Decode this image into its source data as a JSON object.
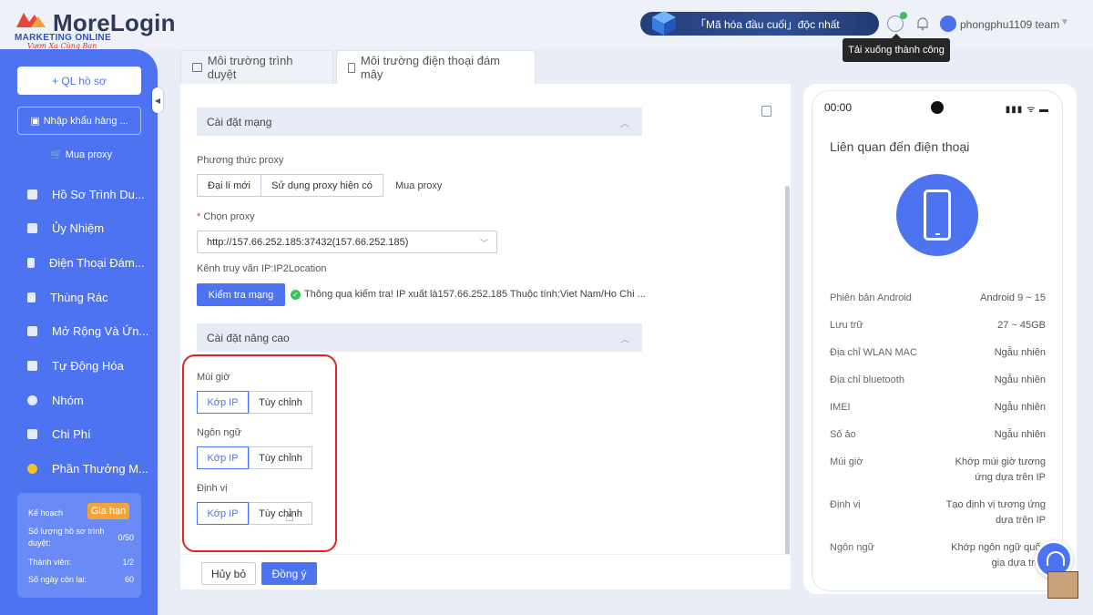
{
  "app": {
    "logo_text": "MoreLogin",
    "watermark_line1": "MARKETING ONLINE",
    "watermark_line2": "Vươn Xa Cùng Bạn",
    "promo_text": "「Mã hóa đầu cuối」độc nhất",
    "username": "phongphu1109 team",
    "tooltip": "Tải xuống thành công"
  },
  "sidebar": {
    "new_profile": "+ QL hồ sơ",
    "import": "Nhập khẩu hàng ...",
    "buy_proxy": "Mua proxy",
    "items": [
      {
        "label": "Hồ Sơ Trình Du...",
        "icon": "browser-profile-icon"
      },
      {
        "label": "Ủy Nhiệm",
        "icon": "delegate-icon"
      },
      {
        "label": "Điện Thoại Đám...",
        "icon": "cloud-phone-icon"
      },
      {
        "label": "Thùng Rác",
        "icon": "trash-icon"
      },
      {
        "label": "Mở Rộng Và Ứn...",
        "icon": "extension-icon"
      },
      {
        "label": "Tự Động Hóa",
        "icon": "robot-icon"
      },
      {
        "label": "Nhóm",
        "icon": "group-icon"
      },
      {
        "label": "Chi Phí",
        "icon": "wallet-icon"
      },
      {
        "label": "Phần Thưởng M...",
        "icon": "reward-icon"
      }
    ],
    "plan": {
      "title": "Kế hoạch",
      "renew": "Gia hạn",
      "rows": [
        {
          "k": "Số lượng hồ sơ trình duyệt:",
          "v": "0/50"
        },
        {
          "k": "Thành viên:",
          "v": "1/2"
        },
        {
          "k": "Số ngày còn lại:",
          "v": "60"
        }
      ]
    }
  },
  "tabs": [
    {
      "label": "Môi trường trình duyệt",
      "active": false
    },
    {
      "label": "Môi trường điện thoại đám mây",
      "active": true
    }
  ],
  "form": {
    "network_section": "Cài đặt mạng",
    "proxy_method_label": "Phương thức proxy",
    "proxy_methods": [
      "Đại lí mới",
      "Sử dụng proxy hiện có"
    ],
    "buy_proxy_link": "Mua proxy",
    "choose_proxy_label": "Chọn proxy",
    "proxy_value": "http://157.66.252.185:37432(157.66.252.185)",
    "ip_channel": "Kênh truy vấn IP:IP2Location",
    "check_button": "Kiểm tra mạng",
    "check_result": "Thông qua kiểm tra! IP xuất là157.66.252.185 Thuộc tính:Viet Nam/Ho Chi ...",
    "advanced_section": "Cài đặt nâng cao",
    "timezone_label": "Múi giờ",
    "language_label": "Ngôn ngữ",
    "location_label": "Định vị",
    "match_ip": "Kớp IP",
    "custom": "Tùy chỉnh",
    "cancel": "Hủy bỏ",
    "confirm": "Đồng ý"
  },
  "phone": {
    "time": "00:00",
    "status": "▮▮▮ ᯤ ▬",
    "title": "Liên quan đến điện thoại",
    "specs": [
      {
        "k": "Phiên bản Android",
        "v": "Android 9 ~ 15"
      },
      {
        "k": "Lưu trữ",
        "v": "27 ~ 45GB"
      },
      {
        "k": "Địa chỉ WLAN MAC",
        "v": "Ngẫu nhiên"
      },
      {
        "k": "Địa chỉ bluetooth",
        "v": "Ngẫu nhiên"
      },
      {
        "k": "IMEI",
        "v": "Ngẫu nhiên"
      },
      {
        "k": "Số ảo",
        "v": "Ngẫu nhiên"
      },
      {
        "k": "Múi giờ",
        "v": "Khớp múi giờ tương ứng dựa trên IP"
      },
      {
        "k": "Định vị",
        "v": "Tạo định vị tương ứng dựa trên IP"
      },
      {
        "k": "Ngôn ngữ",
        "v": "Khớp ngôn ngữ quốc gia dựa trên"
      }
    ]
  },
  "colors": {
    "accent": "#4d73f0",
    "highlight": "#e02424",
    "success": "#3cc25c"
  }
}
